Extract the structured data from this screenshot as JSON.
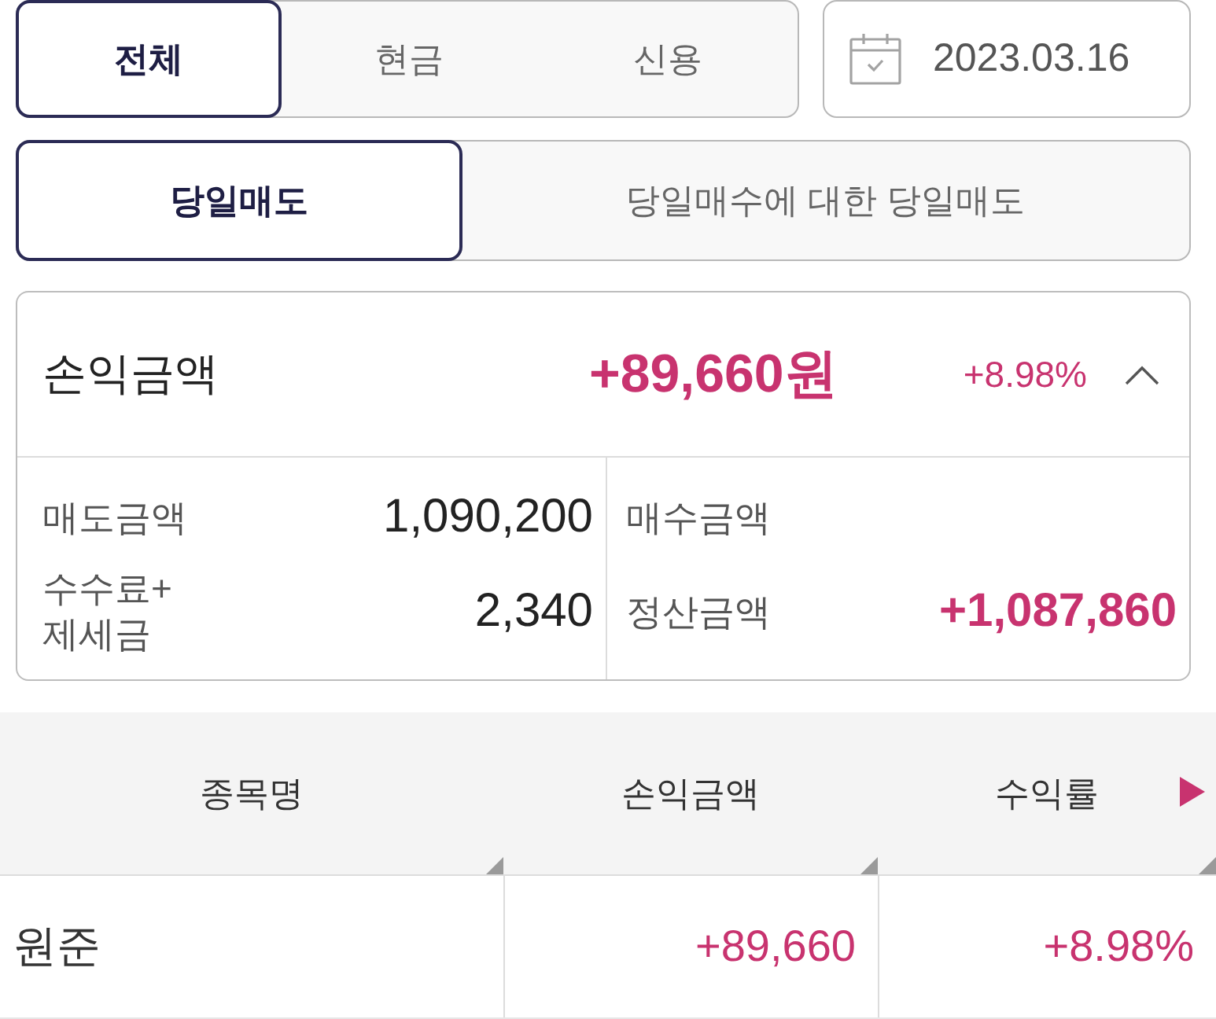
{
  "account_tabs": [
    {
      "label": "전체",
      "selected": true
    },
    {
      "label": "현금",
      "selected": false
    },
    {
      "label": "신용",
      "selected": false
    }
  ],
  "date_field": {
    "value": "2023.03.16"
  },
  "trade_tabs": [
    {
      "label": "당일매도",
      "selected": true
    },
    {
      "label": "당일매수에 대한 당일매도",
      "selected": false
    }
  ],
  "summary": {
    "label": "손익금액",
    "amount": "+89,660원",
    "rate": "+8.98%",
    "expanded": true,
    "detail_columns": [
      [
        {
          "label": "매도금액",
          "value": {
            "text": "1,090,200",
            "highlight": false
          }
        },
        {
          "label": "수수료+ 제세금",
          "value": {
            "text": "2,340",
            "highlight": false
          }
        }
      ],
      [
        {
          "label": "매수금액"
        },
        {
          "label": "정산금액",
          "value": {
            "text": "+1,087,860",
            "highlight": true
          }
        }
      ]
    ]
  },
  "table": {
    "columns": [
      {
        "label": "종목명",
        "kind": "text"
      },
      {
        "label": "손익금액",
        "kind": "amount"
      },
      {
        "label": "수익률",
        "kind": "amount"
      }
    ],
    "rows": [
      {
        "cells": [
          "원준",
          "+89,660",
          "+8.98%"
        ]
      }
    ]
  }
}
